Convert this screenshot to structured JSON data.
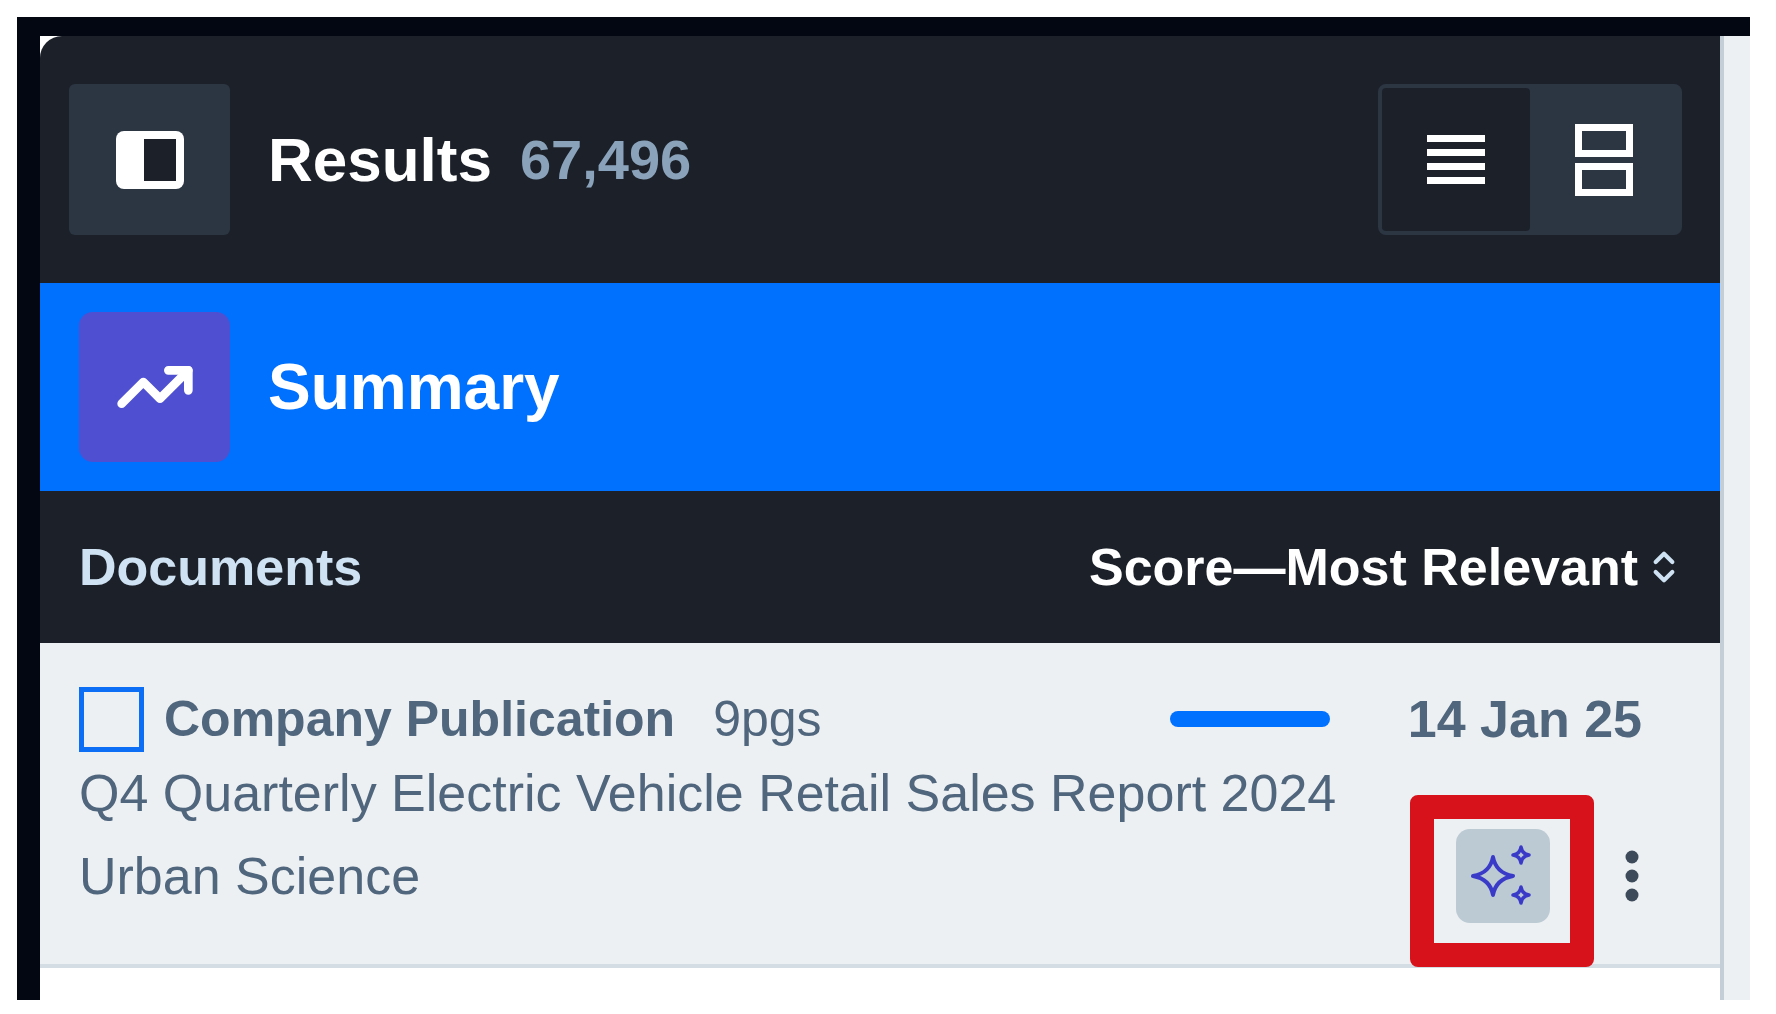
{
  "header": {
    "title": "Results",
    "count": "67,496",
    "views": [
      {
        "kind": "list",
        "selected": true
      },
      {
        "kind": "cards",
        "selected": false
      }
    ]
  },
  "summary": {
    "label": "Summary"
  },
  "documents": {
    "label": "Documents",
    "sort": "Score—Most Relevant"
  },
  "results": [
    {
      "type": "Company Publication",
      "pages": "9pgs",
      "date": "14 Jan 25",
      "title": "Q4 Quarterly Electric Vehicle Retail Sales Report 2024",
      "source": "Urban Science",
      "checked": false,
      "highlighted": true
    }
  ]
}
